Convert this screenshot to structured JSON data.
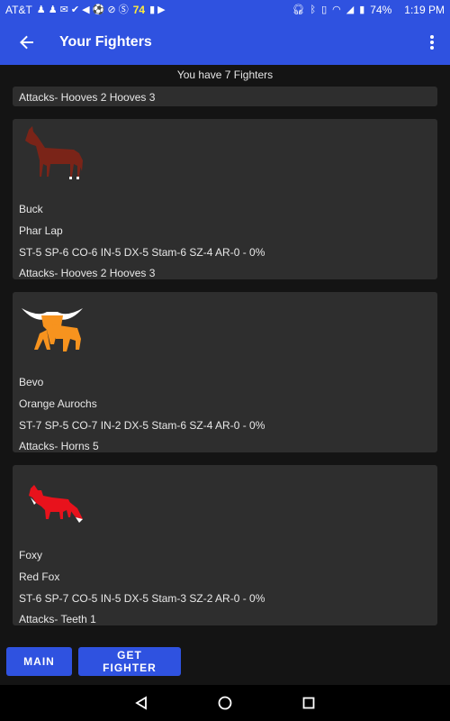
{
  "status_bar": {
    "carrier": "AT&T",
    "badge_number": "74",
    "battery": "74%",
    "time": "1:19 PM"
  },
  "app_bar": {
    "title": "Your Fighters"
  },
  "fighters_count_text": "You have 7 Fighters",
  "cards": [
    {
      "attacks": "Attacks- Hooves 2  Hooves 3"
    },
    {
      "image": "horse-image",
      "name": "Buck",
      "breed": "Phar Lap",
      "stats": "ST-5 SP-6 CO-6 IN-5 DX-5 Stam-6 SZ-4 AR-0 - 0%",
      "attacks": "Attacks- Hooves 2  Hooves 3"
    },
    {
      "image": "longhorn-image",
      "name": "Bevo",
      "breed": "Orange Aurochs",
      "stats": "ST-7 SP-5 CO-7 IN-2 DX-5 Stam-6 SZ-4 AR-0 - 0%",
      "attacks": "Attacks- Horns 5"
    },
    {
      "image": "fox-image",
      "name": "Foxy",
      "breed": "Red Fox",
      "stats": "ST-6 SP-7 CO-5 IN-5 DX-5 Stam-3 SZ-2 AR-0 - 0%",
      "attacks": "Attacks- Teeth 1"
    }
  ],
  "buttons": {
    "main": "MAIN",
    "get_fighter": "GET FIGHTER"
  },
  "colors": {
    "primary": "#2f52e0",
    "background": "#141414",
    "card": "#2e2e2e"
  }
}
